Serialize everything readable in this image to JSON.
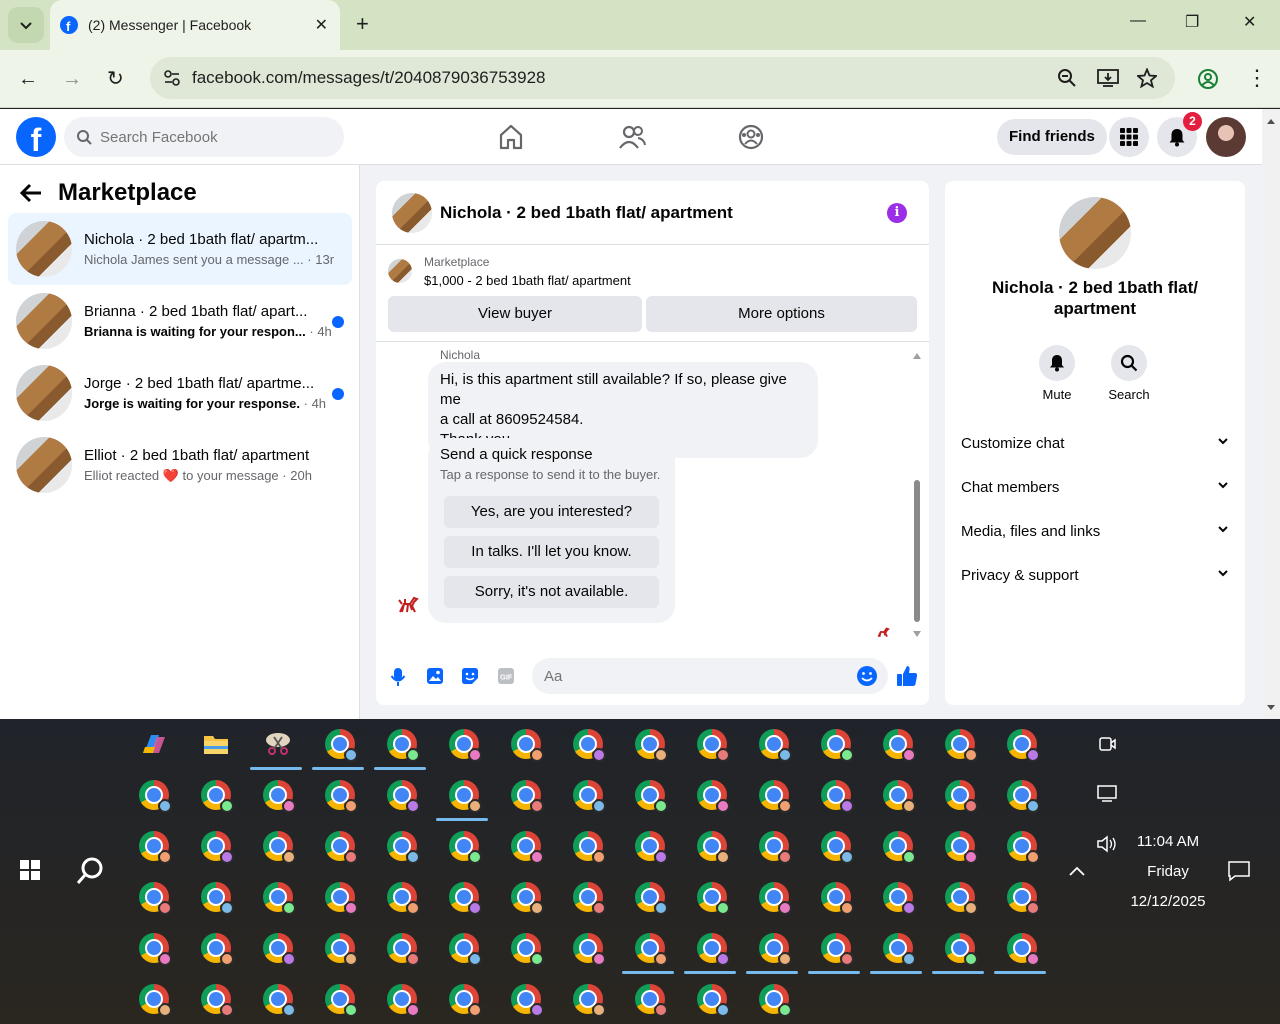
{
  "browser": {
    "tab_title": "(2) Messenger | Facebook",
    "url": "facebook.com/messages/t/2040879036753928"
  },
  "fb": {
    "search_placeholder": "Search Facebook",
    "find_friends": "Find friends",
    "notif_count": "2"
  },
  "left": {
    "title": "Marketplace",
    "conversations": [
      {
        "name": "Nichola · 2 bed 1bath flat/ apartm...",
        "sub": "Nichola James sent you a message ...",
        "time": "· 13m",
        "unread": false
      },
      {
        "name": "Brianna · 2 bed 1bath flat/ apart...",
        "sub": "Brianna is waiting for your respon...",
        "time": "· 4h",
        "unread": true
      },
      {
        "name": "Jorge · 2 bed 1bath flat/ apartme...",
        "sub": "Jorge is waiting for your response.",
        "time": "· 4h",
        "unread": true
      },
      {
        "name": "Elliot · 2 bed 1bath flat/ apartment",
        "sub": "Elliot reacted ❤️ to your message",
        "time": "· 20h",
        "unread": false
      }
    ]
  },
  "chat": {
    "title": "Nichola · 2 bed 1bath flat/ apartment",
    "marketplace_label": "Marketplace",
    "listing": "$1,000 - 2 bed 1bath flat/ apartment",
    "view_buyer": "View buyer",
    "more_options": "More options",
    "sender": "Nichola",
    "message_lines": [
      "Hi, is this apartment still available? If so, please give me",
      "a call at 8609524584.",
      "Thank you"
    ],
    "quick_title": "Send a quick response",
    "quick_sub": "Tap a response to send it to the buyer.",
    "quick_1": "Yes, are you interested?",
    "quick_2": "In talks. I'll let you know.",
    "quick_3": "Sorry, it's not available.",
    "composer_placeholder": "Aa"
  },
  "right": {
    "name": "Nichola · 2 bed 1bath flat/ apartment",
    "mute": "Mute",
    "search": "Search",
    "rows": [
      "Customize chat",
      "Chat members",
      "Media, files and links",
      "Privacy & support"
    ]
  },
  "taskbar": {
    "time": "11:04 AM",
    "day": "Friday",
    "date": "12/12/2025"
  },
  "colors": {
    "fb_blue": "#0866ff",
    "accent_purple": "#9b2fe8"
  }
}
